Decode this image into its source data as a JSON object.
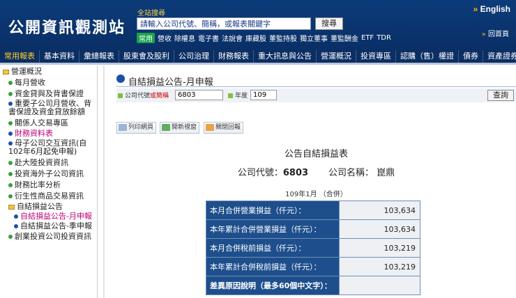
{
  "header": {
    "logo": "公開資訊觀測站",
    "search_label": "全站搜尋",
    "search_placeholder": "請輸入公司代號、簡稱，或報表關鍵字",
    "search_button": "搜尋",
    "quick_badge": "常用",
    "quick_links": [
      "營收",
      "除權息",
      "電子書",
      "法說會",
      "庫藏股",
      "董監持股",
      "獨立董事",
      "董監酬金",
      "ETF",
      "TDR"
    ],
    "english": "English",
    "home": "回首頁"
  },
  "nav": {
    "items": [
      "常用報表",
      "基本資料",
      "彙總報表",
      "股東會及股利",
      "公司治理",
      "財務報表",
      "重大訊息與公告",
      "營運概況",
      "投資專區",
      "認購（售）權證",
      "債券",
      "資產證券化"
    ],
    "active_index": 0
  },
  "sidebar": {
    "items": [
      {
        "label": "營運概況",
        "icon": "folder-open-icon"
      },
      {
        "label": "每月營收",
        "icon": "leaf-icon"
      },
      {
        "label": "資金貸與及背書保證",
        "icon": "leaf-icon"
      },
      {
        "label": "重要子公司月營收、背書保證及資金貸放餘額",
        "icon": "bullet-icon"
      },
      {
        "label": "關係人交易專區",
        "icon": "leaf-icon"
      },
      {
        "label": "財務資料表",
        "icon": "bullet-icon"
      },
      {
        "label": "母子公司交互資訊(自102年6月起免申報)",
        "icon": "bullet-icon"
      },
      {
        "label": "赴大陸投資資訊",
        "icon": "leaf-icon"
      },
      {
        "label": "投資海外子公司資訊",
        "icon": "leaf-icon"
      },
      {
        "label": "財務比率分析",
        "icon": "leaf-icon"
      },
      {
        "label": "衍生性商品交易資訊",
        "icon": "leaf-icon"
      },
      {
        "label": "自結損益公告",
        "icon": "folder-icon"
      },
      {
        "label": "自結損益公告-月申報",
        "icon": "bullet-icon"
      },
      {
        "label": "自結損益公告-季申報",
        "icon": "bullet-icon"
      },
      {
        "label": "創業投資公司投資資訊",
        "icon": "leaf-icon"
      }
    ],
    "highlight_color": "#c0007a"
  },
  "main": {
    "page_title": "自結損益公告-月申報",
    "query": {
      "code_label_1": "公司代號",
      "code_label_2": "或",
      "code_label_3": "簡稱",
      "code_value": "6803",
      "year_label": "年度",
      "year_value": "109",
      "submit": "查詢"
    },
    "tools": [
      "列印網頁",
      "開新視窗",
      "關閉回報"
    ],
    "report_title": "公告自結損益表",
    "company_code_label": "公司代號：",
    "company_code": "6803",
    "company_name_label": "公司名稱：",
    "company_name": "崑鼎",
    "period": "109年1月 （合併）",
    "rows": [
      {
        "label": "本月合併營業損益（仟元）：",
        "value": "103,634"
      },
      {
        "label": "本年累計合併營業損益（仟元）：",
        "value": "103,634"
      },
      {
        "label": "本月合併稅前損益（仟元）：",
        "value": "103,219"
      },
      {
        "label": "本年累計合併稅前損益（仟元）：",
        "value": "103,219"
      },
      {
        "label": "差異原因說明（最多60個中文字）：",
        "value": ""
      }
    ]
  },
  "colors": {
    "header_bg": "#0c3b7a",
    "nav_active": "#ffcf33",
    "table_label_bg": "#1e4f8c"
  }
}
